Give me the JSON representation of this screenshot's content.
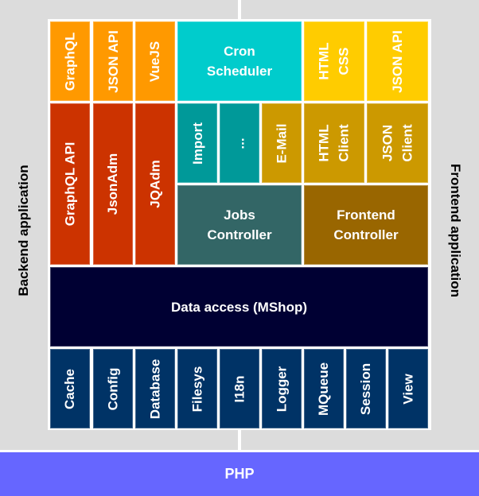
{
  "side_labels": {
    "backend": "Backend application",
    "frontend": "Frontend application"
  },
  "platform": {
    "label": "PHP",
    "color": "#6666ff"
  },
  "top_row": [
    {
      "label": "GraphQL",
      "color": "#ff9900"
    },
    {
      "label": "JSON API",
      "color": "#ff9900"
    },
    {
      "label": "VueJS",
      "color": "#ff9900"
    },
    {
      "label": "Cron\nScheduler",
      "color": "#00cccc"
    },
    {
      "label": "HTML\nCSS",
      "color": "#ffcc00"
    },
    {
      "label": "JSON API",
      "color": "#ffcc00"
    }
  ],
  "admin": [
    {
      "label": "GraphQL API",
      "color": "#cc3300"
    },
    {
      "label": "JsonAdm",
      "color": "#cc3300"
    },
    {
      "label": "JQAdm",
      "color": "#cc3300"
    }
  ],
  "jobs": [
    {
      "label": "Import",
      "color": "#009999"
    },
    {
      "label": "...",
      "color": "#009999"
    },
    {
      "label": "E-Mail",
      "color": "#cc9900"
    }
  ],
  "clients": [
    {
      "label": "HTML\nClient",
      "color": "#cc9900"
    },
    {
      "label": "JSON\nClient",
      "color": "#cc9900"
    }
  ],
  "controllers": [
    {
      "label": "Jobs\nController",
      "color": "#336666"
    },
    {
      "label": "Frontend\nController",
      "color": "#996600"
    }
  ],
  "data_access": {
    "label": "Data access (MShop)",
    "color": "#000033"
  },
  "base": {
    "color": "#003366",
    "items": [
      "Cache",
      "Config",
      "Database",
      "Filesys",
      "I18n",
      "Logger",
      "MQueue",
      "Session",
      "View"
    ]
  }
}
